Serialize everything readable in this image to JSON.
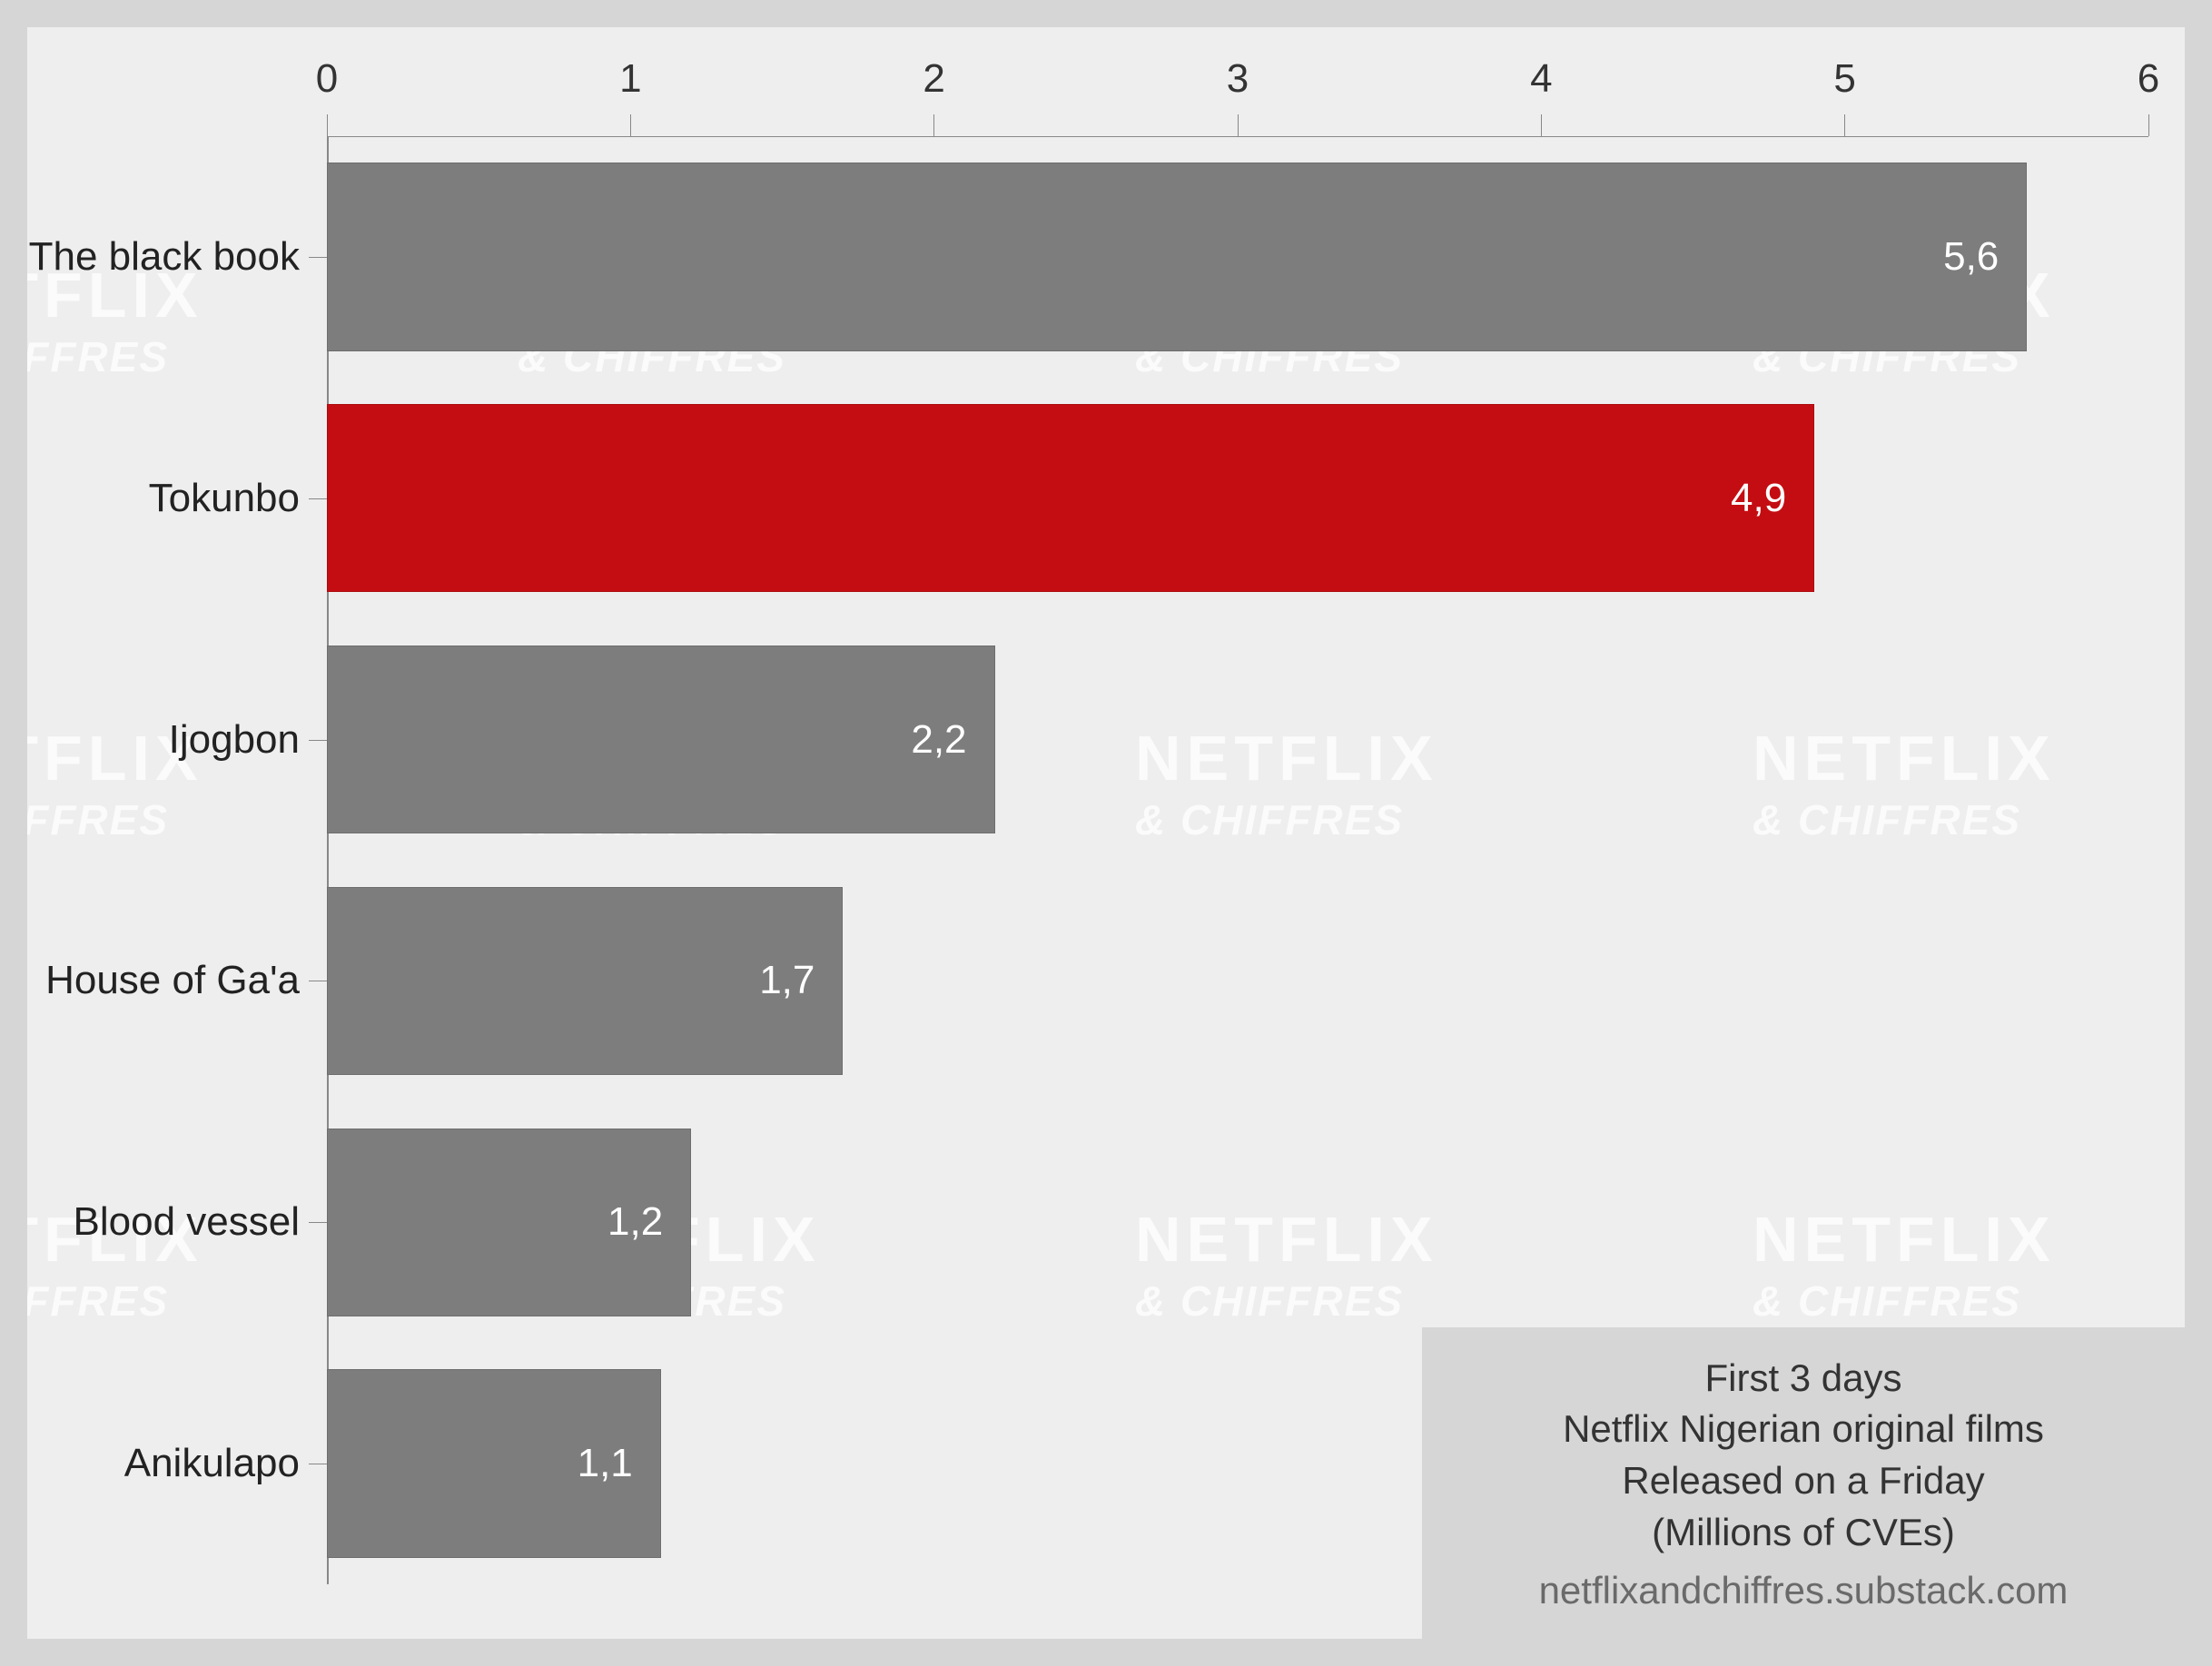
{
  "chart_data": {
    "type": "bar",
    "orientation": "horizontal",
    "categories": [
      "The black book",
      "Tokunbo",
      "Ijogbon",
      "House of Ga'a",
      "Blood vessel",
      "Anikulapo"
    ],
    "values": [
      5.6,
      4.9,
      2.2,
      1.7,
      1.2,
      1.1
    ],
    "value_labels": [
      "5,6",
      "4,9",
      "2,2",
      "1,7",
      "1,2",
      "1,1"
    ],
    "highlight_index": 1,
    "xlabel": "",
    "ylabel": "",
    "xlim": [
      0,
      6
    ],
    "x_ticks": [
      0,
      1,
      2,
      3,
      4,
      5,
      6
    ],
    "colors": {
      "default": "#7d7d7d",
      "highlight": "#c40d12"
    },
    "legend_lines": [
      "First 3 days",
      "Netflix Nigerian original films",
      "Released on a Friday",
      "(Millions of CVEs)"
    ],
    "source": "netflixandchiffres.substack.com",
    "watermark": {
      "top": "NETFLIX",
      "bot": "& CHIFFRES"
    }
  }
}
